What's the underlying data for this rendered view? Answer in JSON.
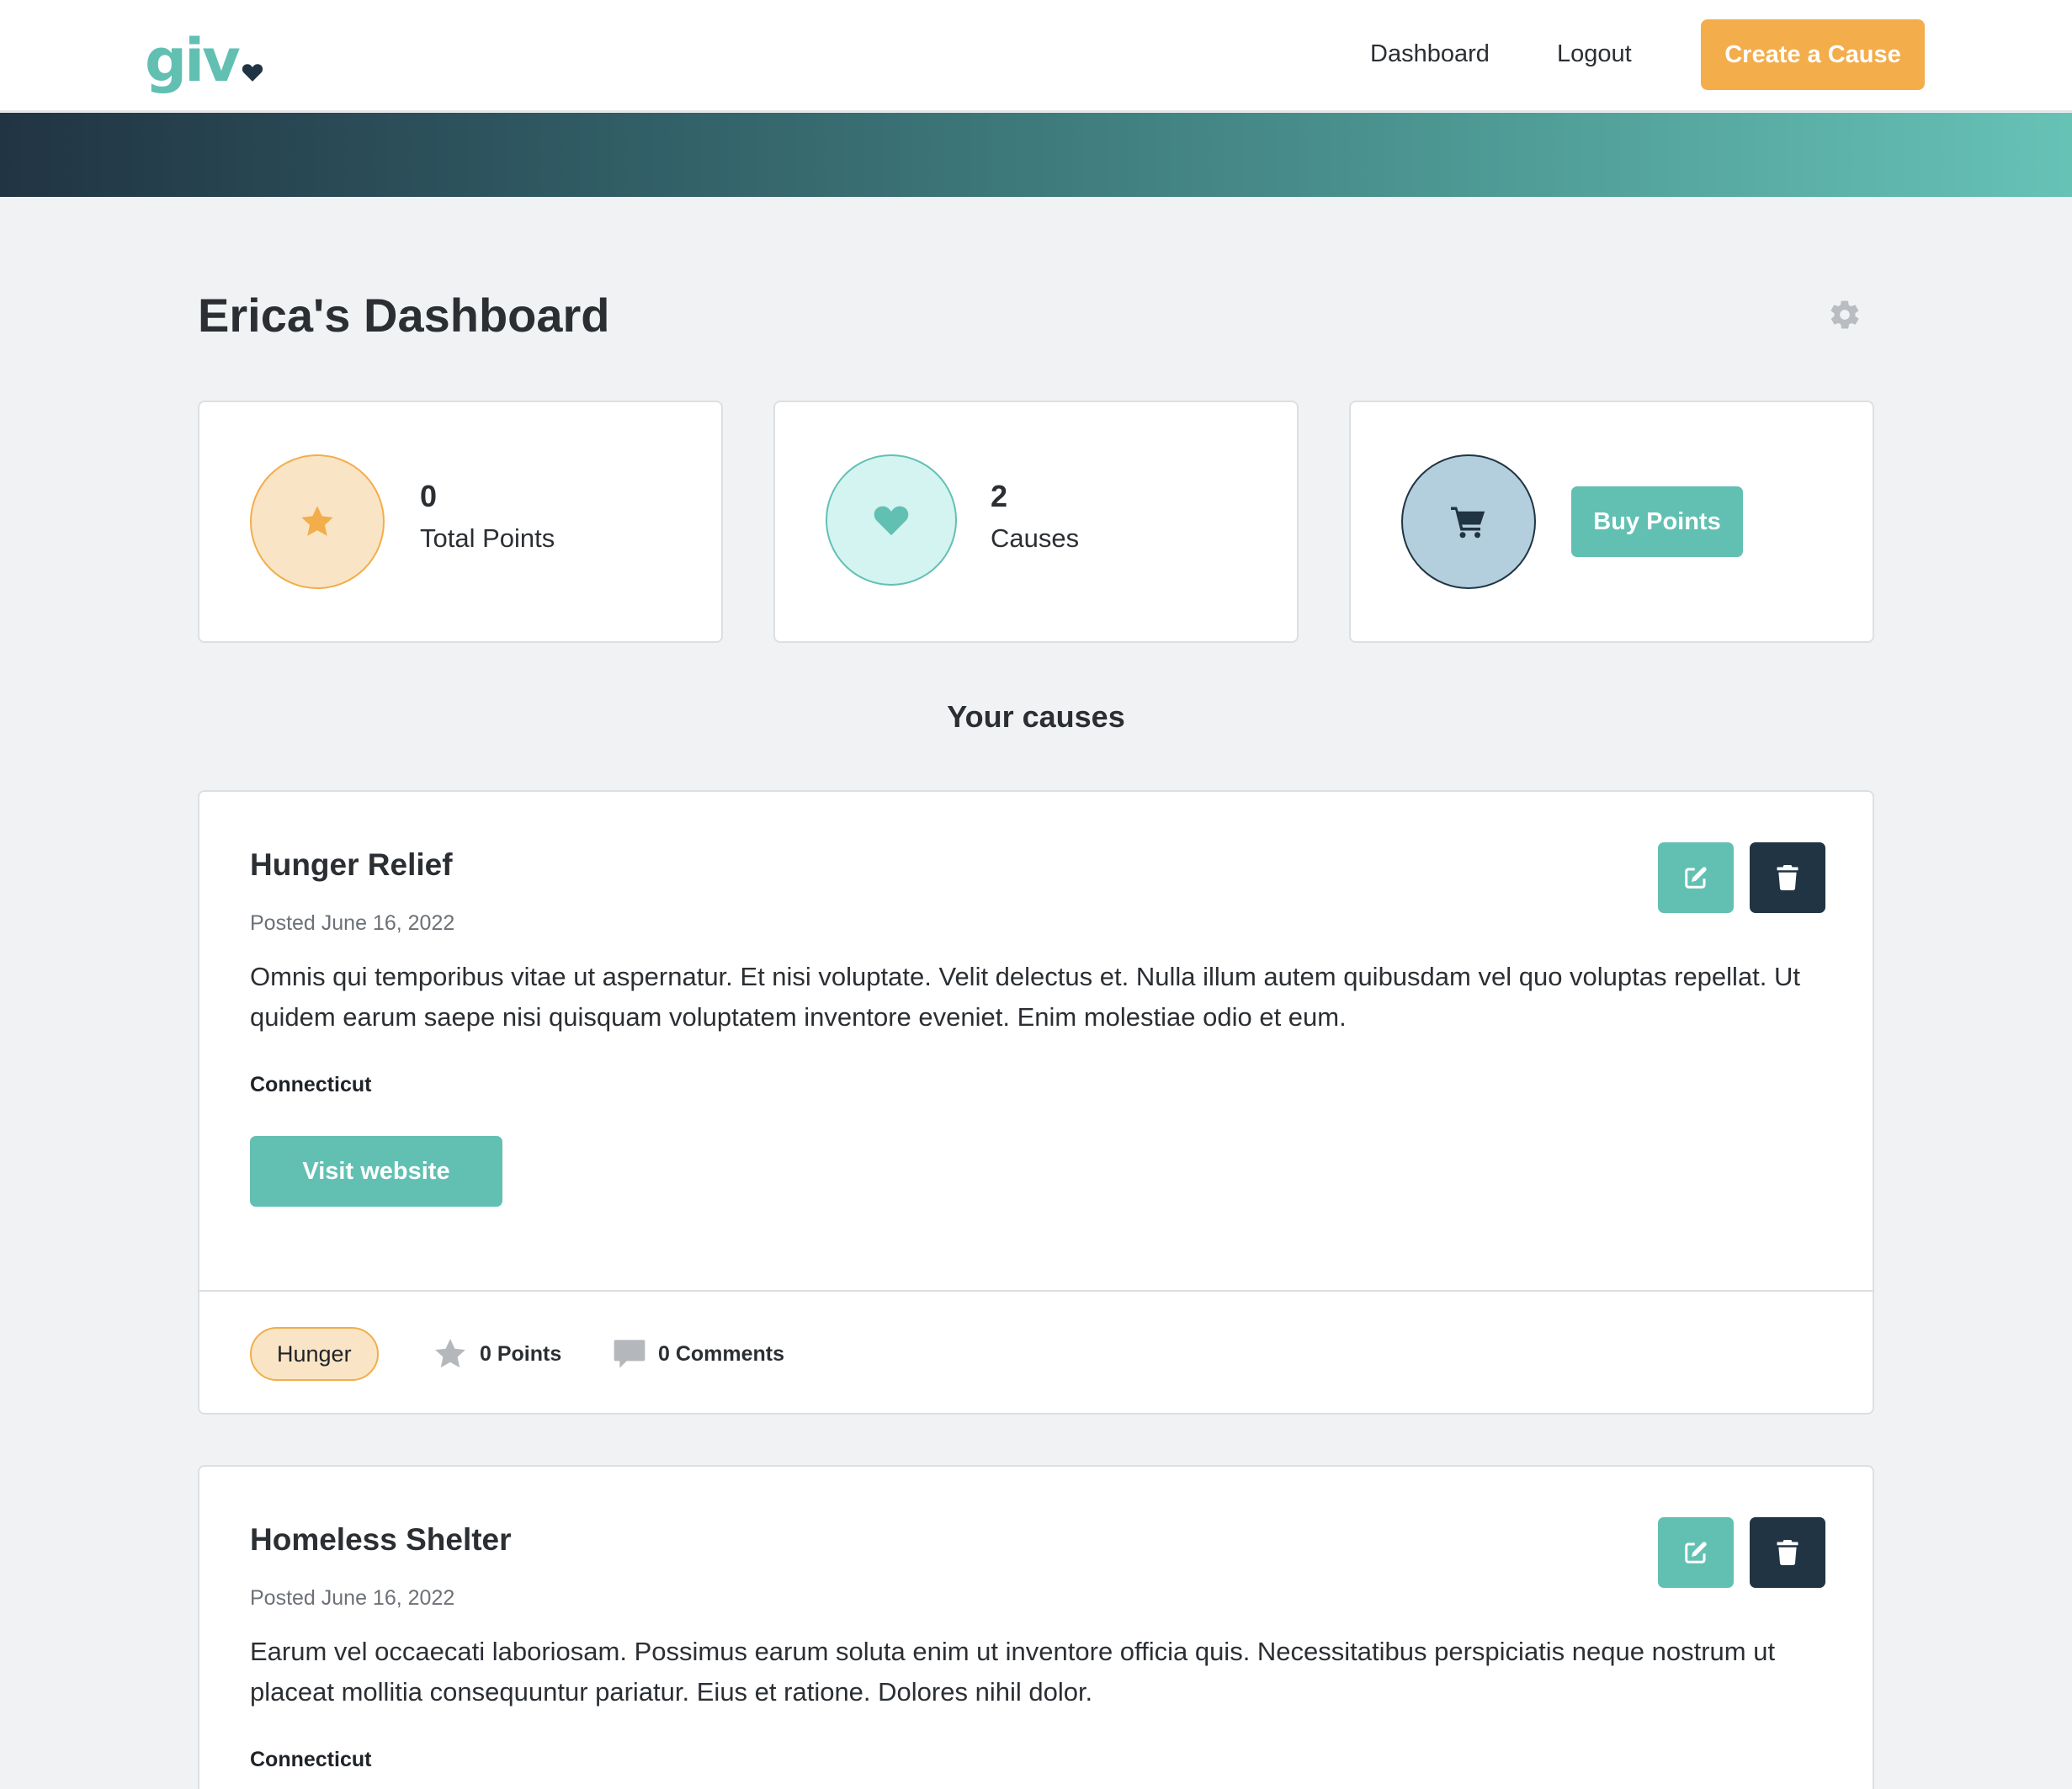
{
  "nav": {
    "logo_text": "giv",
    "links": [
      "Dashboard",
      "Logout"
    ],
    "create_button": "Create a Cause"
  },
  "page": {
    "title": "Erica's Dashboard"
  },
  "stats": {
    "points": {
      "value": "0",
      "label": "Total Points",
      "icon": "star-icon"
    },
    "causes": {
      "value": "2",
      "label": "Causes",
      "icon": "heart-icon"
    },
    "buy": {
      "button_label": "Buy Points",
      "icon": "cart-icon"
    }
  },
  "section_title": "Your causes",
  "causes": [
    {
      "title": "Hunger Relief",
      "date": "Posted June 16, 2022",
      "description": "Omnis qui temporibus vitae ut aspernatur. Et nisi voluptate. Velit delectus et. Nulla illum autem quibusdam vel quo voluptas repellat. Ut quidem earum saepe nisi quisquam voluptatem inventore eveniet. Enim molestiae odio et eum.",
      "location": "Connecticut",
      "visit_label": "Visit website",
      "tag": "Hunger",
      "points": "0 Points",
      "comments": "0 Comments"
    },
    {
      "title": "Homeless Shelter",
      "date": "Posted June 16, 2022",
      "description": "Earum vel occaecati laboriosam. Possimus earum soluta enim ut inventore officia quis. Necessitatibus perspiciatis neque nostrum ut placeat mollitia consequuntur pariatur. Eius et ratione. Dolores nihil dolor.",
      "location": "Connecticut"
    }
  ],
  "colors": {
    "teal": "#62c0b3",
    "orange": "#f3ad4b",
    "navy": "#213443",
    "background": "#f1f2f4"
  }
}
